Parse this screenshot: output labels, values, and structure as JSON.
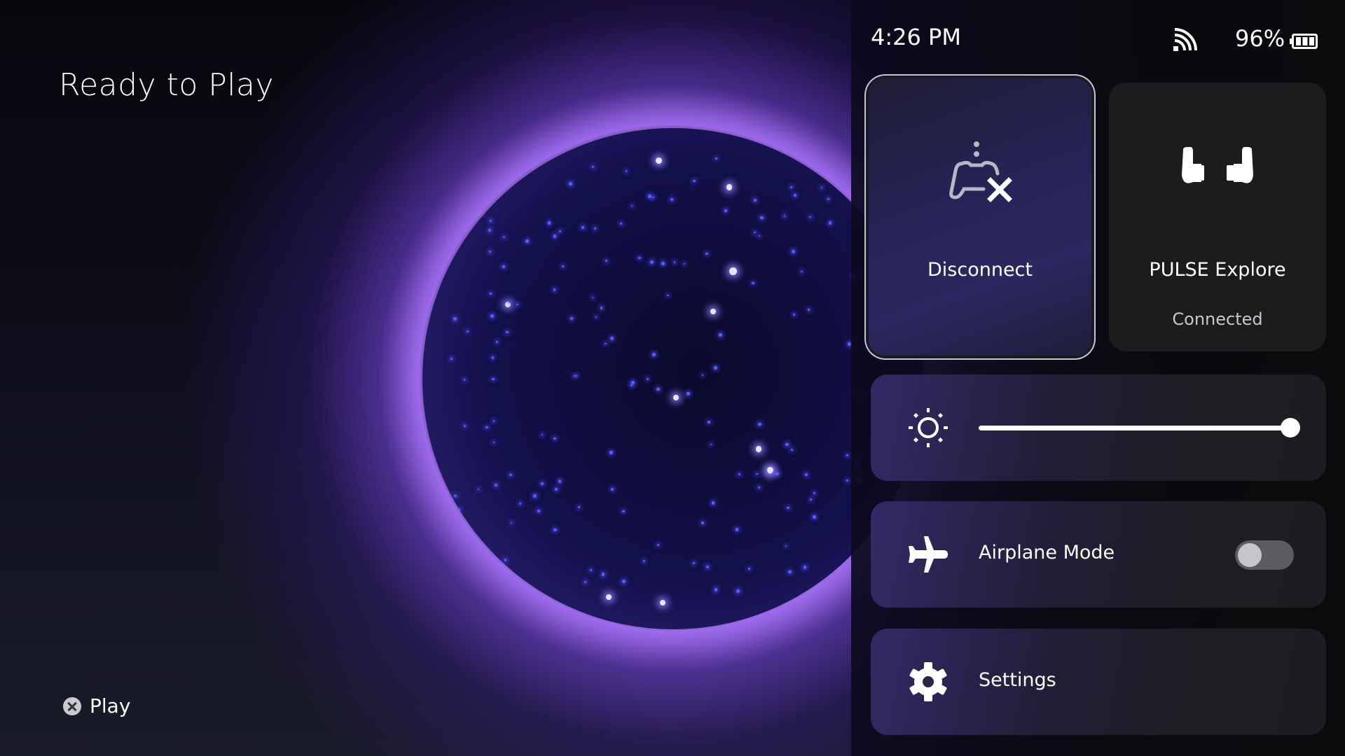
{
  "background": {
    "title": "Ready to Play",
    "hint": {
      "button_icon": "cross-button-icon",
      "label": "Play"
    }
  },
  "status_bar": {
    "time": "4:26 PM",
    "network_icon": "remote-play-signal-icon",
    "battery_percent": "96%",
    "battery_icon": "battery-icon"
  },
  "quick_menu": {
    "tiles": [
      {
        "id": "disconnect",
        "label": "Disconnect",
        "icon": "controller-disconnect-icon",
        "focused": true
      },
      {
        "id": "pulse-explore",
        "label": "PULSE Explore",
        "status": "Connected",
        "icon": "earbuds-icon",
        "focused": false
      }
    ],
    "brightness": {
      "icon": "brightness-icon",
      "value_fraction": 1.0
    },
    "airplane_mode": {
      "label": "Airplane Mode",
      "icon": "airplane-icon",
      "enabled": false
    },
    "settings": {
      "label": "Settings",
      "icon": "gear-icon"
    }
  },
  "colors": {
    "accent_glow": "#aa6eff",
    "panel_bg": "#0b0b0e",
    "tile_bg": "#1c1c1f",
    "toggle_off": "#5b5b60"
  }
}
